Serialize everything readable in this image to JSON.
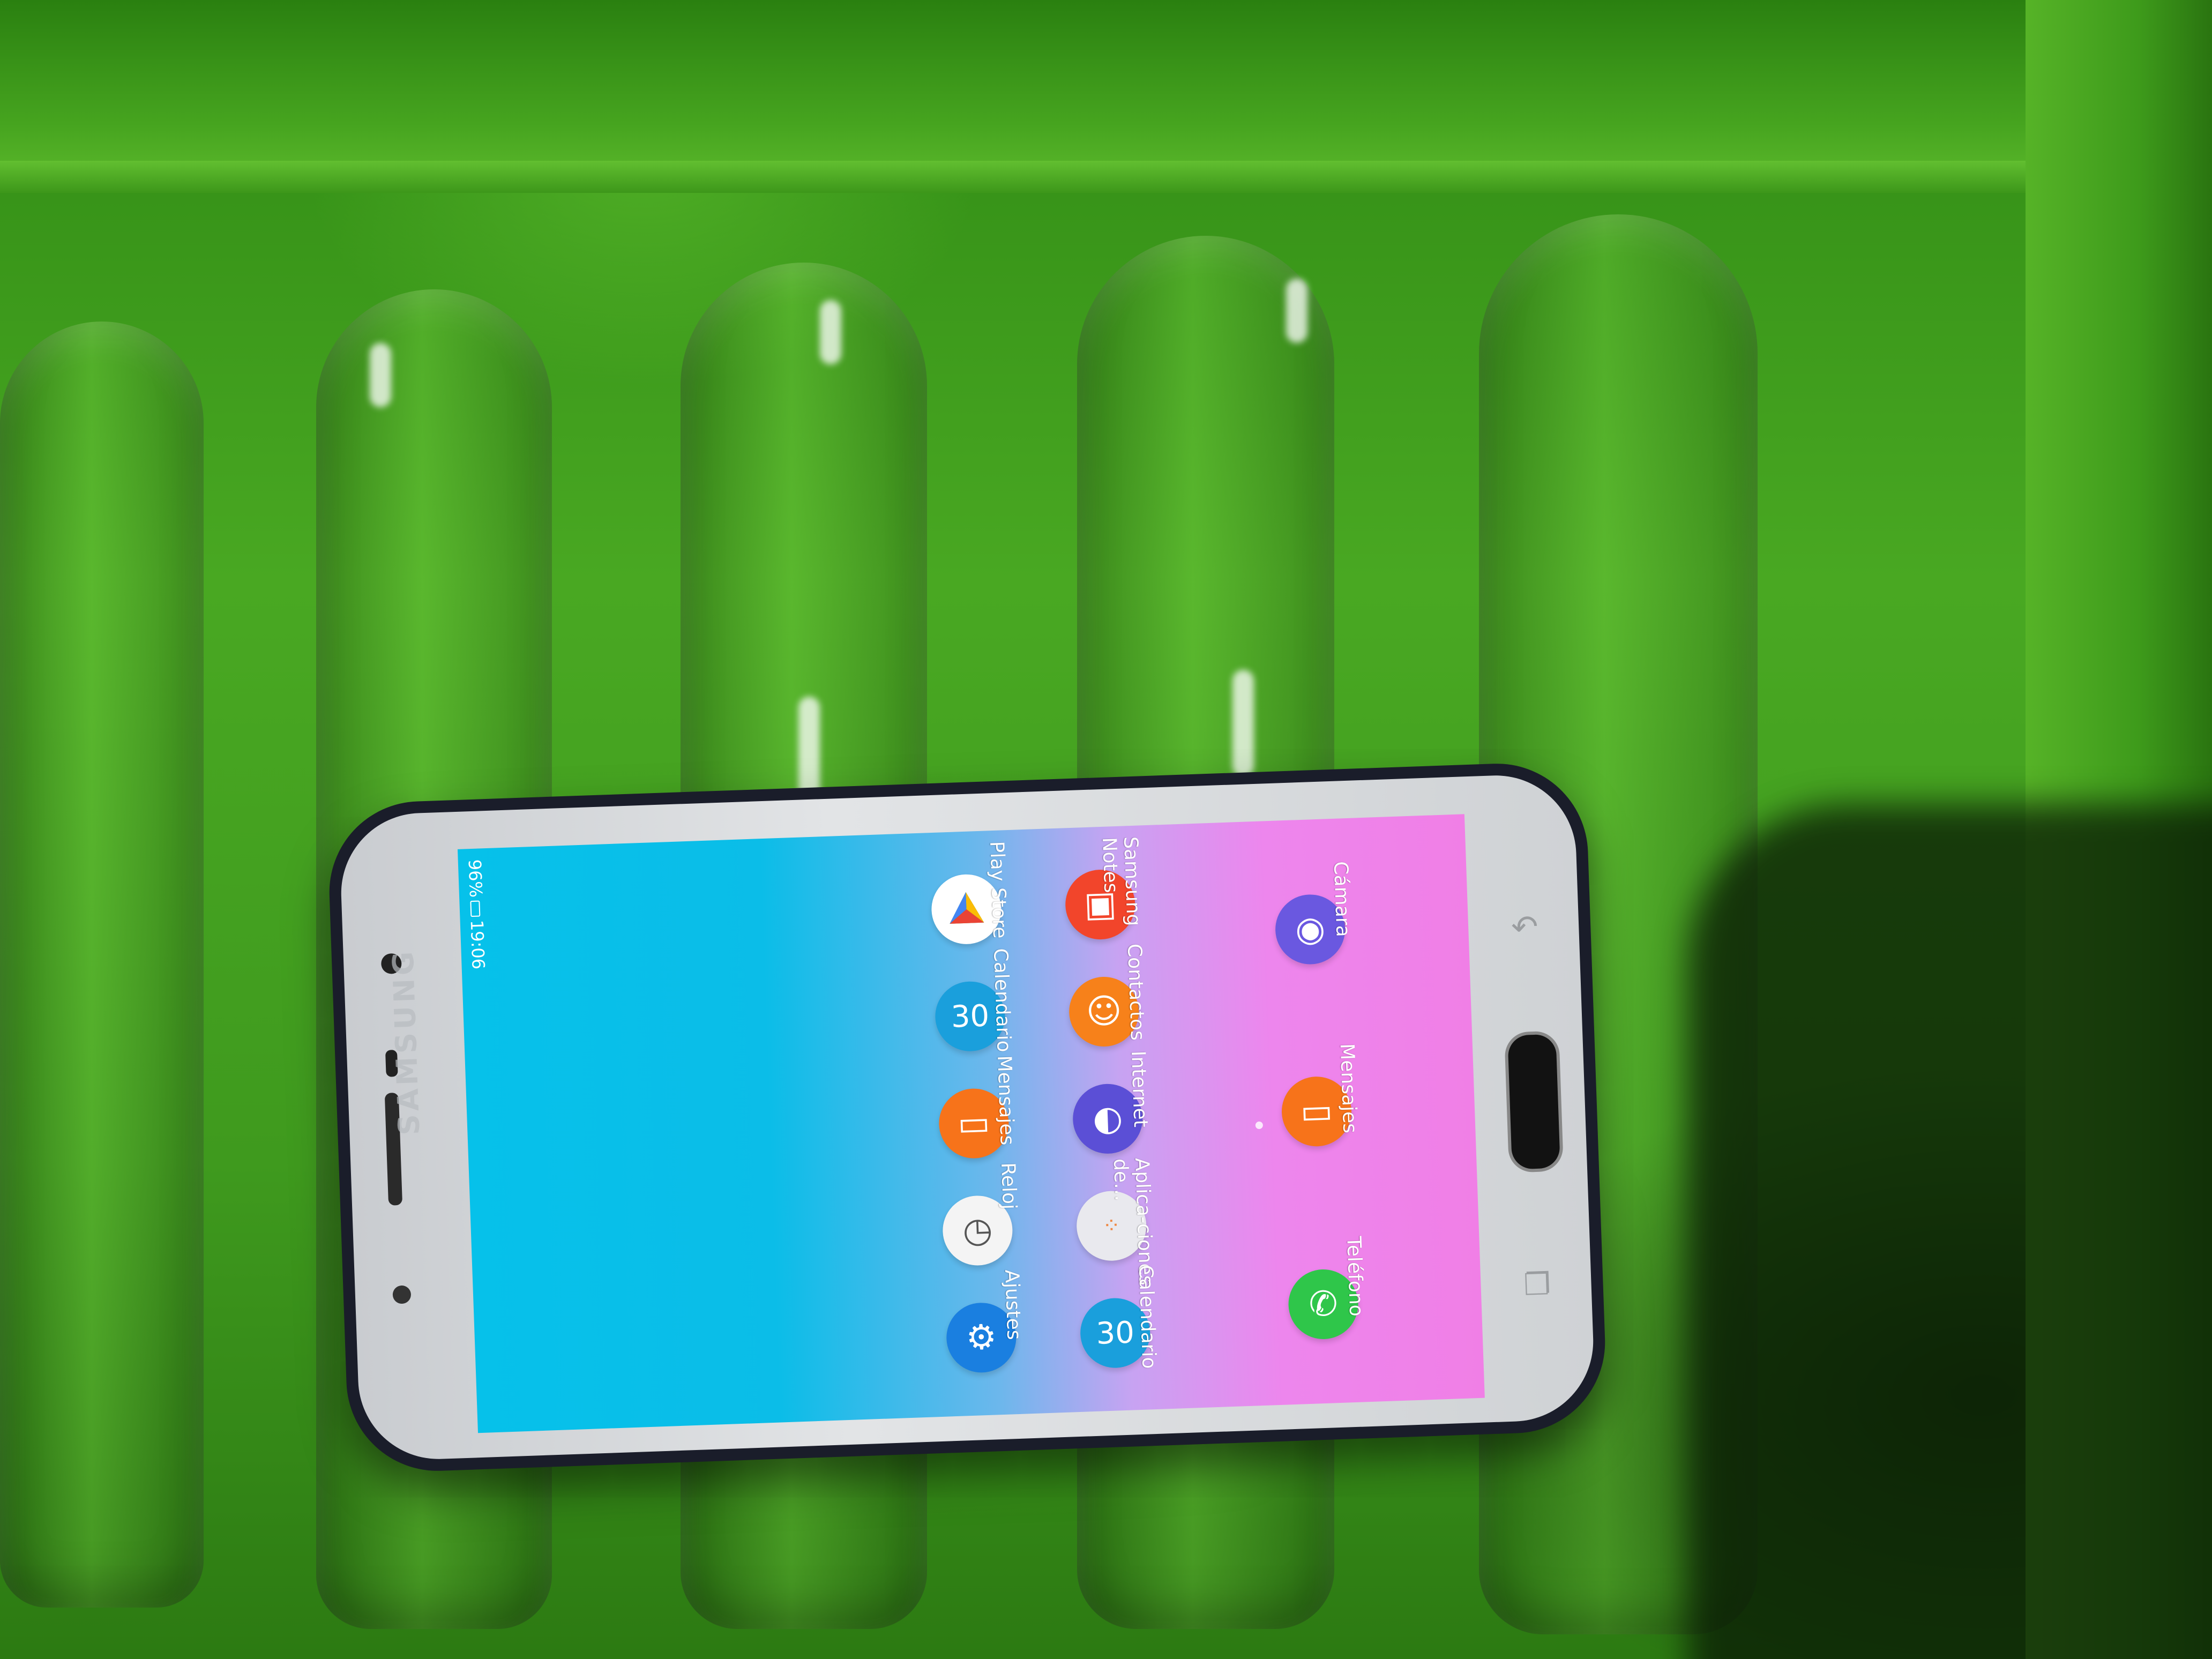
{
  "status_bar": {
    "battery": "96%",
    "time": "19:06"
  },
  "device": {
    "brand": "SAMSUNG"
  },
  "apps": [
    {
      "id": "play-store",
      "label": "Play Store",
      "icon": "play-store-icon",
      "color": "#ffffff"
    },
    {
      "id": "calendario",
      "label": "Calendario",
      "icon": "calendar-icon",
      "color": "#1a9fdc"
    },
    {
      "id": "mensajes",
      "label": "Mensajes",
      "icon": "messages-icon",
      "color": "#f7731a"
    },
    {
      "id": "reloj",
      "label": "Reloj",
      "icon": "clock-icon",
      "color": "#f4f4f4"
    },
    {
      "id": "ajustes",
      "label": "Ajustes",
      "icon": "settings-icon",
      "color": "#1a7fe0"
    },
    {
      "id": "samsung-notes",
      "label": "Samsung Notes",
      "icon": "notes-icon",
      "color": "#f2452b"
    },
    {
      "id": "contactos",
      "label": "Contactos",
      "icon": "contacts-icon",
      "color": "#f7811a"
    },
    {
      "id": "internet",
      "label": "Internet",
      "icon": "internet-icon",
      "color": "#5b4fd6"
    },
    {
      "id": "aplicaciones",
      "label": "Aplica-ciones de...",
      "icon": "folder-icon",
      "color": "#e9e9ee"
    },
    {
      "id": "calendario-2",
      "label": "Calendario",
      "icon": "calendar-icon",
      "color": "#1a9fdc"
    },
    {
      "id": "camara",
      "label": "Cámara",
      "icon": "camera-icon",
      "color": "#6a58e0"
    },
    {
      "id": "mensajes-dock",
      "label": "Mensajes",
      "icon": "messages-icon",
      "color": "#f7731a"
    },
    {
      "id": "telefono",
      "label": "Teléfono",
      "icon": "phone-icon",
      "color": "#2fc64a"
    }
  ]
}
